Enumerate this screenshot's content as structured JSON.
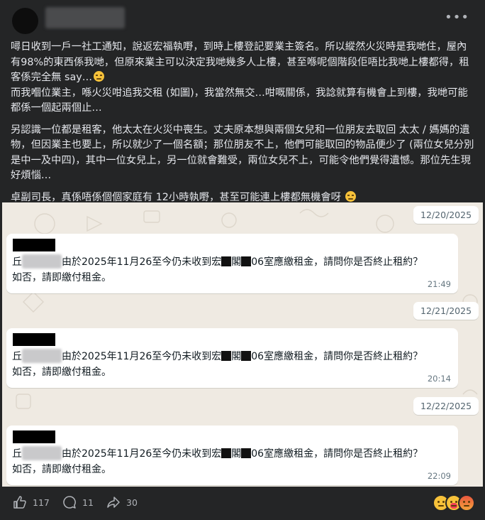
{
  "post": {
    "more_icon": "ellipsis-icon",
    "paragraphs": [
      "噚日收到一戶一社工通知，說返宏福執嘢，到時上樓登記要業主簽名。所以縱然火災時是我哋住，屋內有98%的東西係我哋，但原來業主可以決定我哋幾多人上樓，甚至喺呢個階段佢唔比我哋上樓都得，租客係完全無 say…",
      "而我嗰位業主，喺火災咁追我交租 (如圖)，我當然無交…咁嘅關係，我諗就算有機會上到樓，我哋可能都係一個起兩個止…",
      "另認識一位都是租客，他太太在火災中喪生。丈夫原本想與兩個女兒和一位朋友去取回 太太 / 媽媽的遺物，但因業主也要上，所以就少了一個名額；那位朋友不上，他們可能取回的物品便少了 (兩位女兒分別是中一及中四)，其中一位女兒上，另一位就會難受，兩位女兒不上，可能令他們覺得遺憾。那位先生現好煩惱…",
      "卓副司長，真係唔係個個家庭有 12小時執嘢，甚至可能連上樓都無機會呀"
    ]
  },
  "chat": {
    "messages": [
      {
        "date": "12/20/2025",
        "prefix": "丘",
        "text_a": "由於2025年11月26至今仍未收到宏",
        "text_b": "閣",
        "text_c": "06室應繳租金，請問你是否終止租約？",
        "line2": "如否，請即繳付租金。",
        "time": "21:49"
      },
      {
        "date": "12/21/2025",
        "prefix": "丘",
        "text_a": "由於2025年11月26至今仍未收到宏",
        "text_b": "閣",
        "text_c": "06室應繳租金，請問你是否終止租約？",
        "line2": "如否，請即繳付租金。",
        "time": "20:14"
      },
      {
        "date": "12/22/2025",
        "prefix": "丘",
        "text_a": "由於2025年11月26至今仍未收到宏",
        "text_b": "閣",
        "text_c": "06室應繳租金，請問你是否終止租約？",
        "line2": "如否，請即繳付租金。",
        "time": "22:09"
      }
    ]
  },
  "footer": {
    "likes": "117",
    "comments": "11",
    "shares": "30",
    "reactions": [
      "sad-emoji",
      "care-emoji",
      "angry-emoji"
    ]
  }
}
